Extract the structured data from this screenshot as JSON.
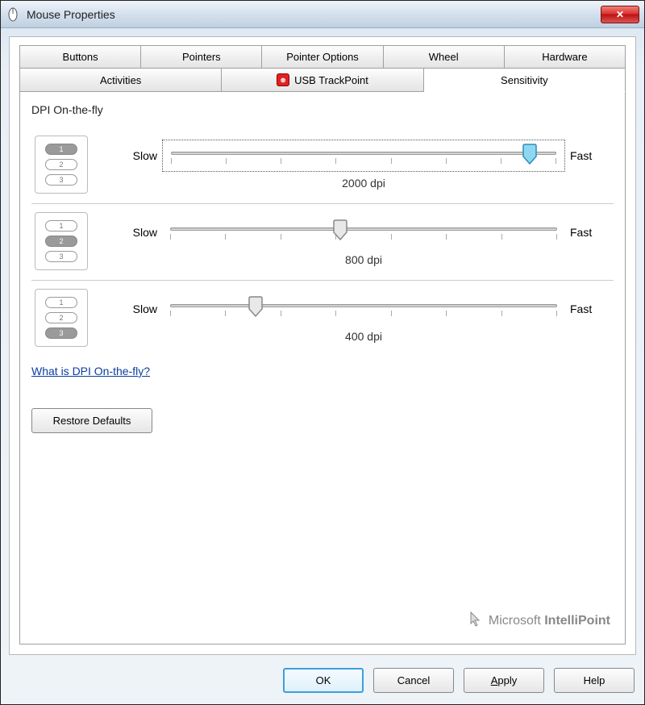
{
  "window": {
    "title": "Mouse Properties"
  },
  "tabs": {
    "row1": [
      "Buttons",
      "Pointers",
      "Pointer Options",
      "Wheel",
      "Hardware"
    ],
    "row2": [
      "Activities",
      "USB TrackPoint",
      "Sensitivity"
    ],
    "active": "Sensitivity"
  },
  "group": {
    "label": "DPI On-the-fly",
    "help_link": "What is DPI On-the-fly?"
  },
  "sliders": [
    {
      "slow": "Slow",
      "fast": "Fast",
      "readout": "2000 dpi",
      "position_pct": 93,
      "blue": true,
      "filled_index": 0
    },
    {
      "slow": "Slow",
      "fast": "Fast",
      "readout": "800 dpi",
      "position_pct": 44,
      "blue": false,
      "filled_index": 1
    },
    {
      "slow": "Slow",
      "fast": "Fast",
      "readout": "400 dpi",
      "position_pct": 22,
      "blue": false,
      "filled_index": 2
    }
  ],
  "buttons": {
    "restore": "Restore Defaults",
    "ok": "OK",
    "cancel": "Cancel",
    "apply": "Apply",
    "help": "Help"
  },
  "branding": {
    "prefix": "Microsoft ",
    "bold": "IntelliPoint"
  }
}
